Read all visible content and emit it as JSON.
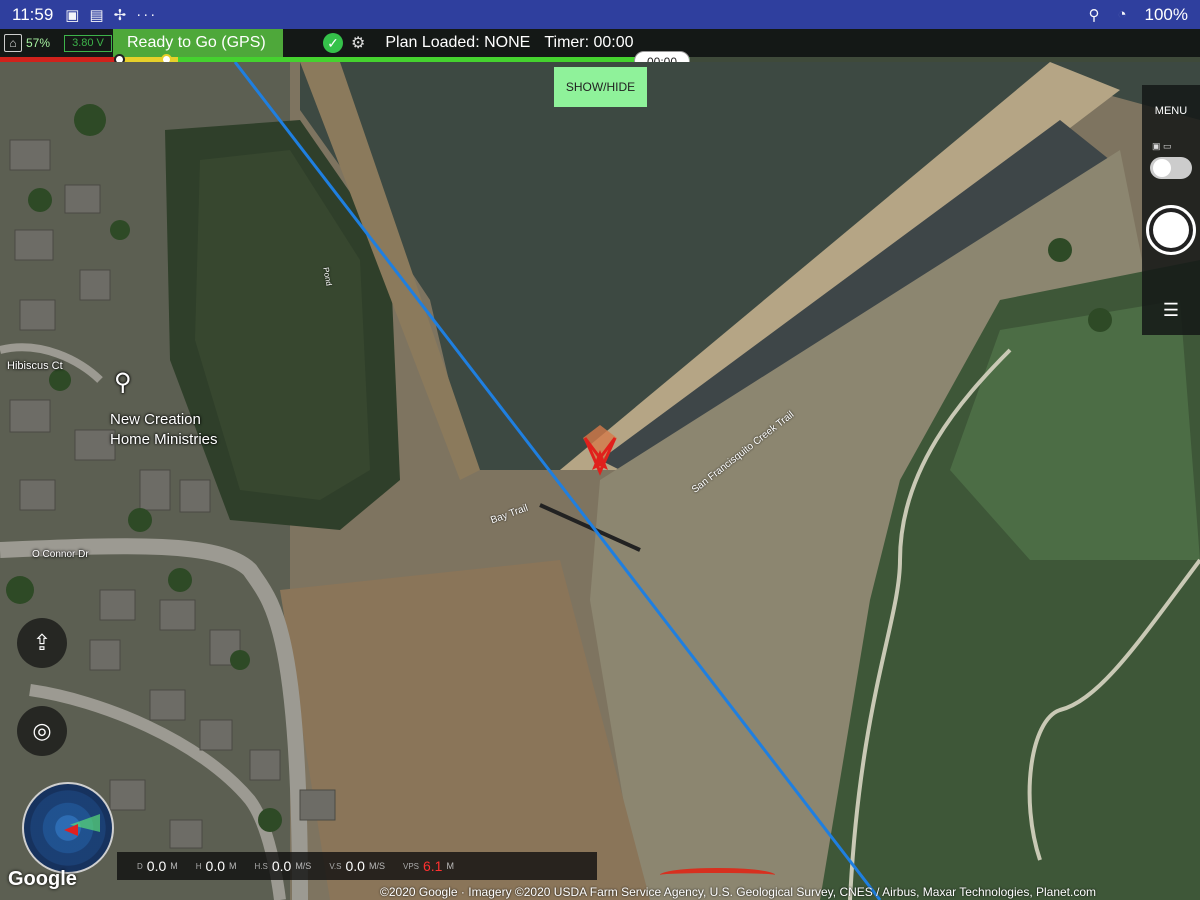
{
  "status_bar": {
    "time": "11:59",
    "battery": "100%"
  },
  "top_bar": {
    "battery_pct": "57%",
    "voltage": "3.80 V",
    "status": "Ready to Go (GPS)",
    "plan": "Plan Loaded: NONE",
    "timer": "Timer: 00:00",
    "timer_pill": "00:00"
  },
  "show_hide_label": "SHOW/HIDE",
  "right_panel": {
    "menu_label": "MENU"
  },
  "map_labels": {
    "street1": "Hibiscus Ct",
    "church_line1": "New Creation",
    "church_line2": "Home Ministries",
    "street2": "O Connor Dr",
    "trail1": "San Francisquito Creek Trail",
    "trail2": "Bay Trail",
    "pond": "Pond"
  },
  "telemetry": {
    "d_label": "D",
    "d_value": "0.0",
    "d_unit": "M",
    "h_label": "H",
    "h_value": "0.0",
    "h_unit": "M",
    "hs_label": "H.S",
    "hs_value": "0.0",
    "hs_unit": "M/S",
    "vs_label": "V.S",
    "vs_value": "0.0",
    "vs_unit": "M/S",
    "vps_label": "VPS",
    "vps_value": "6.1",
    "vps_unit": "M"
  },
  "attribution": {
    "google": "Google",
    "copyright": "©2020 Google · Imagery ©2020 USDA Farm Service Agency, U.S. Geological Survey, CNES / Airbus, Maxar Technologies, Planet.com"
  },
  "colors": {
    "status_bar": "#2f3f9e",
    "ready": "#4ea83a",
    "flight_line": "#1f7fe0",
    "aircraft": "#e0201c"
  },
  "icons": [
    "home-point-icon",
    "check-circle-icon",
    "satellite-icon",
    "location-icon",
    "wifi-icon",
    "battery-icon",
    "settings-icon",
    "upload-icon",
    "compass-icon"
  ]
}
